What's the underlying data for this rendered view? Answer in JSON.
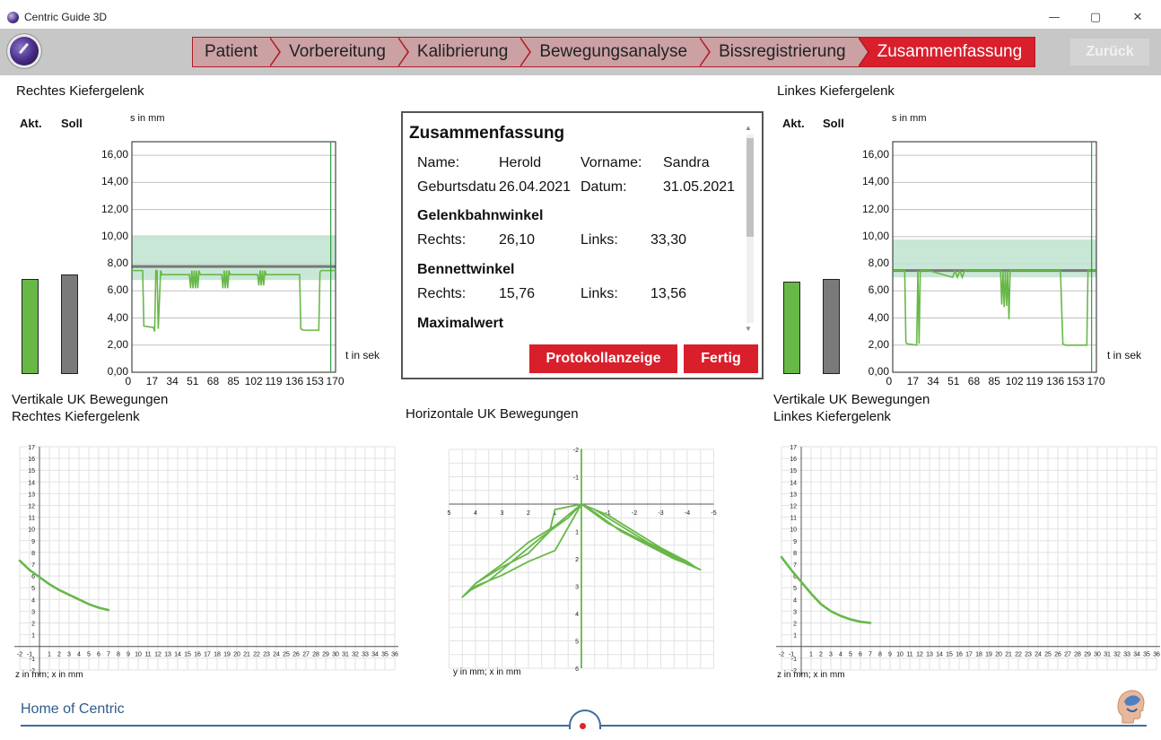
{
  "window": {
    "title": "Centric Guide 3D",
    "minimize": "—",
    "restore": "▢",
    "close": "✕"
  },
  "nav": {
    "steps": [
      "Patient",
      "Vorbereitung",
      "Kalibrierung",
      "Bewegungsanalyse",
      "Bissregistrierung",
      "Zusammenfassung"
    ],
    "active_index": 5,
    "back_label": "Zurück"
  },
  "colors": {
    "accent": "#d81f2b",
    "step_inactive": "#cba1a4",
    "green": "#68b848",
    "band": "#bfe3cf"
  },
  "right_joint": {
    "title": "Rechtes Kiefergelenk",
    "akt_label": "Akt.",
    "soll_label": "Soll",
    "y_unit": "s in mm",
    "x_unit": "t in sek",
    "akt_value": 6.9,
    "soll_value": 7.2
  },
  "left_joint": {
    "title": "Linkes Kiefergelenk",
    "akt_label": "Akt.",
    "soll_label": "Soll",
    "y_unit": "s in mm",
    "x_unit": "t in sek",
    "akt_value": 6.7,
    "soll_value": 6.9
  },
  "time_chart": {
    "y_ticks": [
      "16,00",
      "14,00",
      "12,00",
      "10,00",
      "8,00",
      "6,00",
      "4,00",
      "2,00",
      "0,00"
    ],
    "x_ticks": [
      "0",
      "17",
      "34",
      "51",
      "68",
      "85",
      "102",
      "119",
      "136",
      "153",
      "170"
    ]
  },
  "summary": {
    "title": "Zusammenfassung",
    "name_label": "Name:",
    "name_value": "Herold",
    "vorname_label": "Vorname:",
    "vorname_value": "Sandra",
    "geb_label": "Geburtsdatu",
    "geb_value": "26.04.2021",
    "datum_label": "Datum:",
    "datum_value": "31.05.2021",
    "gelenk_heading": "Gelenkbahnwinkel",
    "gelenk_rechts_label": "Rechts:",
    "gelenk_rechts_value": "26,10",
    "gelenk_links_label": "Links:",
    "gelenk_links_value": "33,30",
    "bennett_heading": "Bennettwinkel",
    "bennett_rechts_label": "Rechts:",
    "bennett_rechts_value": "15,76",
    "bennett_links_label": "Links:",
    "bennett_links_value": "13,56",
    "max_heading": "Maximalwert",
    "protokoll_btn": "Protokollanzeige",
    "fertig_btn": "Fertig"
  },
  "vertical_right": {
    "title_line1": "Vertikale UK Bewegungen",
    "title_line2": "Rechtes Kiefergelenk",
    "caption": "z in mm; x in mm"
  },
  "vertical_left": {
    "title_line1": "Vertikale UK Bewegungen",
    "title_line2": "Linkes Kiefergelenk",
    "caption": "z in mm; x in mm"
  },
  "horizontal": {
    "title": "Horizontale UK Bewegungen",
    "caption": "y in mm; x in mm"
  },
  "footer": {
    "text": "Home of Centric"
  },
  "chart_data": [
    {
      "type": "line",
      "title": "Rechtes Kiefergelenk",
      "xlabel": "t in sek",
      "ylabel": "s in mm",
      "xlim": [
        0,
        170
      ],
      "ylim": [
        0,
        17
      ],
      "band": [
        6.8,
        10.1
      ],
      "reference": 7.8,
      "series": [
        {
          "x": [
            0,
            5,
            9,
            10,
            18,
            19,
            20,
            21,
            22,
            24,
            25,
            35,
            48,
            49,
            50,
            51,
            52,
            53,
            54,
            55,
            56,
            57,
            60,
            70,
            75,
            76,
            77,
            78,
            79,
            80,
            81,
            82,
            95,
            105,
            106,
            107,
            108,
            109,
            110,
            111,
            112,
            116,
            140,
            141,
            143,
            156,
            157,
            158,
            170
          ],
          "y": [
            7.5,
            7.5,
            7.5,
            3.4,
            3.3,
            3.0,
            7.5,
            7.5,
            3.2,
            7.5,
            7.2,
            7.2,
            7.2,
            6.2,
            7.5,
            6.2,
            7.5,
            6.2,
            7.5,
            6.2,
            7.5,
            7.2,
            7.2,
            7.2,
            7.2,
            6.2,
            7.5,
            6.2,
            7.5,
            6.2,
            7.5,
            7.2,
            7.2,
            7.2,
            6.4,
            7.5,
            6.4,
            7.5,
            6.4,
            7.5,
            7.2,
            7.2,
            7.2,
            3.2,
            3.1,
            3.1,
            7.4,
            7.5,
            7.5
          ]
        }
      ],
      "marker_x": 166
    },
    {
      "type": "line",
      "title": "Linkes Kiefergelenk",
      "xlabel": "t in sek",
      "ylabel": "s in mm",
      "xlim": [
        0,
        170
      ],
      "ylim": [
        0,
        17
      ],
      "band": [
        7.0,
        9.8
      ],
      "reference": 7.5,
      "series": [
        {
          "x": [
            0,
            10,
            11,
            12,
            20,
            21,
            22,
            23,
            30,
            50,
            52,
            54,
            56,
            58,
            60,
            62,
            90,
            91,
            92,
            93,
            94,
            95,
            96,
            97,
            98,
            110,
            140,
            142,
            144,
            162,
            163,
            164,
            170
          ],
          "y": [
            7.5,
            7.5,
            2.2,
            2.1,
            2.0,
            7.5,
            2.1,
            7.5,
            7.5,
            7.0,
            7.5,
            7.0,
            7.5,
            7.0,
            7.5,
            7.5,
            7.5,
            5.0,
            7.5,
            4.8,
            7.5,
            4.9,
            7.5,
            3.9,
            7.5,
            7.5,
            7.5,
            2.1,
            2.0,
            2.0,
            7.5,
            7.5,
            7.5
          ]
        }
      ],
      "marker_x": 166
    },
    {
      "type": "line",
      "title": "Vertikale UK Bewegungen Rechtes Kiefergelenk",
      "xlabel": "z in mm; x in mm",
      "xlim": [
        -2,
        36
      ],
      "ylim": [
        -2,
        17
      ],
      "series": [
        {
          "x": [
            -2,
            -1,
            0,
            1,
            2,
            3,
            4,
            5,
            6,
            7
          ],
          "y": [
            7.3,
            6.5,
            5.9,
            5.3,
            4.8,
            4.4,
            4.0,
            3.6,
            3.3,
            3.1
          ]
        }
      ]
    },
    {
      "type": "line",
      "title": "Horizontale UK Bewegungen",
      "xlabel": "y in mm; x in mm",
      "xlim": [
        5,
        -5
      ],
      "ylim": [
        -2,
        6
      ],
      "series": [
        {
          "x": [
            0,
            0,
            0,
            0.5,
            1.5,
            2.5,
            3.5,
            4.3,
            4.5,
            4.0,
            3.0,
            2.0,
            1.0,
            0,
            -1.0,
            -2.0,
            -3.0,
            -4.0,
            -4.3,
            -3.5,
            -2.5,
            -1.5,
            -0.5,
            0,
            1.0,
            2.0,
            3.0,
            4.0,
            4.5,
            4.0,
            3.0,
            2.0,
            1.2,
            1.0,
            0,
            -0.5,
            -1.5,
            -2.5,
            -3.5,
            -4.5,
            -4.0,
            -3.0,
            -2.0,
            -1.0,
            0
          ],
          "y": [
            6,
            -2,
            0,
            0.5,
            1.2,
            2.0,
            2.8,
            3.2,
            3.4,
            3.0,
            2.6,
            2.1,
            1.7,
            0,
            0.4,
            1.0,
            1.6,
            2.1,
            2.3,
            2.0,
            1.5,
            1.0,
            0.3,
            0,
            0.8,
            1.4,
            2.2,
            2.9,
            3.4,
            2.9,
            2.3,
            1.8,
            1.0,
            0.2,
            0,
            0.2,
            0.8,
            1.4,
            1.9,
            2.4,
            2.2,
            1.7,
            1.2,
            0.7,
            0
          ]
        }
      ]
    },
    {
      "type": "line",
      "title": "Vertikale UK Bewegungen Linkes Kiefergelenk",
      "xlabel": "z in mm; x in mm",
      "xlim": [
        -2,
        36
      ],
      "ylim": [
        -2,
        17
      ],
      "series": [
        {
          "x": [
            -2,
            -1,
            0,
            1,
            2,
            3,
            4,
            5,
            6,
            7
          ],
          "y": [
            7.6,
            6.5,
            5.5,
            4.5,
            3.6,
            3.0,
            2.6,
            2.3,
            2.1,
            2.0
          ]
        }
      ]
    }
  ]
}
